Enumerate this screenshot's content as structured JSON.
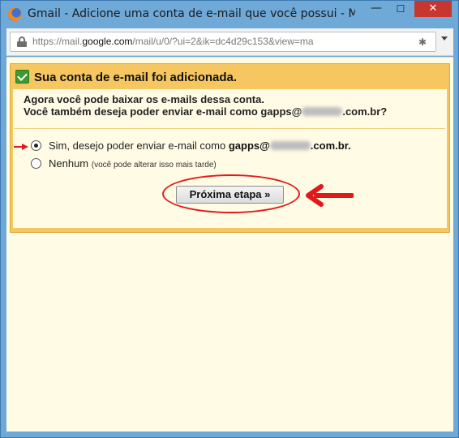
{
  "window": {
    "title": "Gmail - Adicione uma conta de e-mail que você possui - Mozilla Firefox",
    "minimize_glyph": "—",
    "maximize_glyph": "☐",
    "close_glyph": "✕"
  },
  "urlbar": {
    "url_prefix": "https://mail.",
    "url_host": "google.com",
    "url_suffix": "/mail/u/0/?ui=2&ik=dc4d29c153&view=ma",
    "lock_icon": "lock-icon",
    "extension_icon": "settings-icon"
  },
  "panel": {
    "title": "Sua conta de e-mail foi adicionada.",
    "line1": "Agora você pode baixar os e-mails dessa conta.",
    "line2_prefix": "Você também deseja poder enviar e-mail como gapps@",
    "line2_suffix": ".com.br?",
    "options": [
      {
        "label_prefix": "Sim, desejo poder enviar e-mail como ",
        "label_bold_prefix": "gapps@",
        "label_bold_suffix": ".com.br.",
        "checked": true
      },
      {
        "label": "Nenhum",
        "note": "(você pode alterar isso mais tarde)",
        "checked": false
      }
    ],
    "next_button": "Próxima etapa »"
  },
  "colors": {
    "titlebar": "#6fa9d8",
    "panel": "#f6c760",
    "content_bg": "#fffbe5",
    "annotation_red": "#e01919",
    "check_green": "#3c9a2f"
  }
}
